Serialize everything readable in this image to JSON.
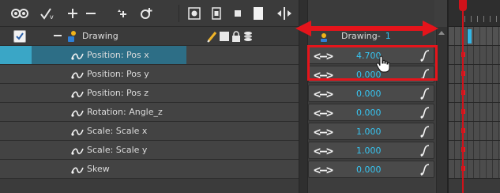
{
  "toolbar": {
    "icons": [
      {
        "name": "onion-skin-icon"
      },
      {
        "name": "add-drawing-icon"
      },
      {
        "name": "add-layer-icon"
      },
      {
        "name": "remove-layer-icon"
      },
      {
        "name": "add-peg-icon"
      },
      {
        "name": "layer-properties-icon"
      },
      {
        "name": "show-all-icon"
      },
      {
        "name": "toggle-layer-icon"
      },
      {
        "name": "small-square-icon"
      },
      {
        "name": "display-icon"
      },
      {
        "name": "timeline-split-icon"
      }
    ]
  },
  "header_row": {
    "checked": true,
    "layer_name": "Drawing",
    "value_name": "Drawing-",
    "value_number": "1",
    "tool_icons": [
      "pencil-icon",
      "color-swatch-icon",
      "lock-icon",
      "stack-icon"
    ]
  },
  "functions": [
    {
      "label": "Position: Pos x",
      "value": "4.700",
      "selected": true
    },
    {
      "label": "Position: Pos y",
      "value": "0.000",
      "selected": false
    },
    {
      "label": "Position: Pos z",
      "value": "0.000",
      "selected": false
    },
    {
      "label": "Rotation: Angle_z",
      "value": "0.000",
      "selected": false
    },
    {
      "label": "Scale: Scale x",
      "value": "1.000",
      "selected": false
    },
    {
      "label": "Scale: Scale y",
      "value": "1.000",
      "selected": false
    },
    {
      "label": "Skew",
      "value": "0.000",
      "selected": false
    }
  ],
  "arrow_glyph": "<—>",
  "colors": {
    "selection": "#2d6e86",
    "selection_lead": "#3aa6c6",
    "value_text": "#37c4f0",
    "annotation_red": "#e5141b",
    "playhead": "#d0121a"
  }
}
